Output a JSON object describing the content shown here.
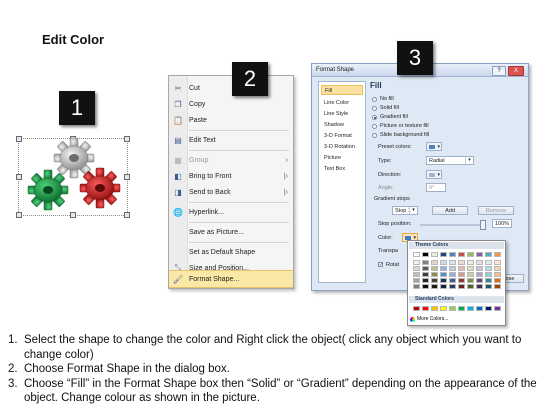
{
  "title": "Edit Color",
  "steps": {
    "one": "1",
    "two": "2",
    "three": "3"
  },
  "context_menu": {
    "items": [
      {
        "label": "Cut",
        "icon": "cut-icon"
      },
      {
        "label": "Copy",
        "icon": "copy-icon"
      },
      {
        "label": "Paste",
        "icon": "paste-icon"
      },
      {
        "label": "Edit Text",
        "icon": "edit-text-icon"
      },
      {
        "label": "Group",
        "icon": "group-icon"
      },
      {
        "label": "Bring to Front",
        "icon": "bring-to-front-icon"
      },
      {
        "label": "Send to Back",
        "icon": "send-to-back-icon"
      },
      {
        "label": "Hyperlink...",
        "icon": "hyperlink-icon"
      },
      {
        "label": "Save as Picture...",
        "icon": ""
      },
      {
        "label": "Set as Default Shape",
        "icon": ""
      },
      {
        "label": "Size and Position...",
        "icon": "size-position-icon"
      },
      {
        "label": "Format Shape...",
        "icon": "format-shape-icon"
      }
    ]
  },
  "dialog": {
    "title": "Format Shape",
    "help": "?",
    "close": "X",
    "categories": [
      "Fill",
      "Line Color",
      "Line Style",
      "Shadow",
      "3-D Format",
      "3-D Rotation",
      "Picture",
      "Text Box"
    ],
    "selected_category": "Fill",
    "section_title": "Fill",
    "fill_options": [
      "No fill",
      "Solid fill",
      "Gradient fill",
      "Picture or texture fill",
      "Slide background fill"
    ],
    "selected_fill": "Gradient fill",
    "preset_colors_label": "Preset colors:",
    "type_label": "Type:",
    "type_value": "Radial",
    "direction_label": "Direction:",
    "angle_label": "Angle:",
    "angle_value": "0°",
    "gradient_stops_label": "Gradient stops",
    "stop_value": "Stop 1",
    "add_button": "Add",
    "remove_button": "Remove",
    "stop_position_label": "Stop position:",
    "stop_position_value": "100%",
    "color_label": "Color:",
    "transparency_label": "Transpa",
    "rotate_label": "Rotat",
    "close_button": "ose"
  },
  "color_popup": {
    "theme_header": "Theme Colors",
    "standard_header": "Standard Colors",
    "more_colors": "More Colors...",
    "theme_top": [
      "#ffffff",
      "#000000",
      "#eeece1",
      "#1f497d",
      "#4f81bd",
      "#c0504d",
      "#9bbb59",
      "#8064a2",
      "#4bacc6",
      "#f79646"
    ],
    "theme_shades": [
      [
        "#f2f2f2",
        "#7f7f7f",
        "#ddd9c3",
        "#c6d9f0",
        "#dbe5f1",
        "#f2dcdb",
        "#ebf1dd",
        "#e5e0ec",
        "#dbeef3",
        "#fdeada"
      ],
      [
        "#d8d8d8",
        "#595959",
        "#c4bd97",
        "#8db3e2",
        "#b8cce4",
        "#e5b9b7",
        "#d7e3bc",
        "#ccc1d9",
        "#b7dde8",
        "#fbd5b5"
      ],
      [
        "#bfbfbf",
        "#3f3f3f",
        "#938953",
        "#548dd4",
        "#95b3d7",
        "#d99694",
        "#c3d69b",
        "#b2a2c7",
        "#92cddc",
        "#fac08f"
      ],
      [
        "#a5a5a5",
        "#262626",
        "#494429",
        "#17365d",
        "#366092",
        "#953734",
        "#76923c",
        "#5f497a",
        "#31859b",
        "#e36c09"
      ],
      [
        "#7f7f7f",
        "#0c0c0c",
        "#1d1b10",
        "#0f243e",
        "#244061",
        "#632423",
        "#4f6128",
        "#3f3151",
        "#205867",
        "#974806"
      ]
    ],
    "standard": [
      "#c00000",
      "#ff0000",
      "#ffc000",
      "#ffff00",
      "#92d050",
      "#00b050",
      "#00b0f0",
      "#0070c0",
      "#002060",
      "#7030a0"
    ]
  },
  "instructions": [
    {
      "num": "1.",
      "text": "Select the shape to change the color and Right click the object( click any object which you want to change color)"
    },
    {
      "num": "2.",
      "text": "Choose Format Shape in the dialog box."
    },
    {
      "num": "3.",
      "text": "Choose “Fill” in the Format Shape box then “Solid” or “Gradient” depending on the appearance of the object. Change colour as shown in the picture."
    }
  ]
}
